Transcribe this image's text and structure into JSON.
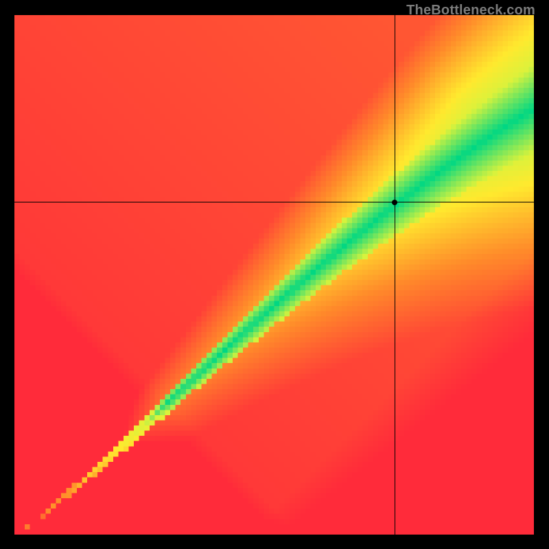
{
  "attribution": "TheBottleneck.com",
  "chart_data": {
    "type": "heatmap",
    "title": "",
    "xlabel": "",
    "ylabel": "",
    "xlim": [
      0,
      1
    ],
    "ylim": [
      0,
      1
    ],
    "grid": false,
    "legend": false,
    "marker": {
      "x": 0.732,
      "y": 0.64
    },
    "crosshair": {
      "x": 0.732,
      "y": 0.64
    },
    "colormap": {
      "description": "red → orange → yellow → green along a diagonal optimum band",
      "stops": [
        {
          "t": 0.0,
          "color": "#ff2b3a"
        },
        {
          "t": 0.4,
          "color": "#ff8a2a"
        },
        {
          "t": 0.72,
          "color": "#ffe92e"
        },
        {
          "t": 0.88,
          "color": "#d9f23c"
        },
        {
          "t": 1.0,
          "color": "#00d783"
        }
      ]
    },
    "optimum_band": {
      "description": "green region: widening curved band along diagonal from origin to top-right",
      "lower_slope_start": 1.05,
      "upper_slope_start": 1.3,
      "lower_slope_end": 0.7,
      "upper_slope_end": 0.94,
      "curve_exponent": 1.18
    },
    "resolution": 100
  }
}
